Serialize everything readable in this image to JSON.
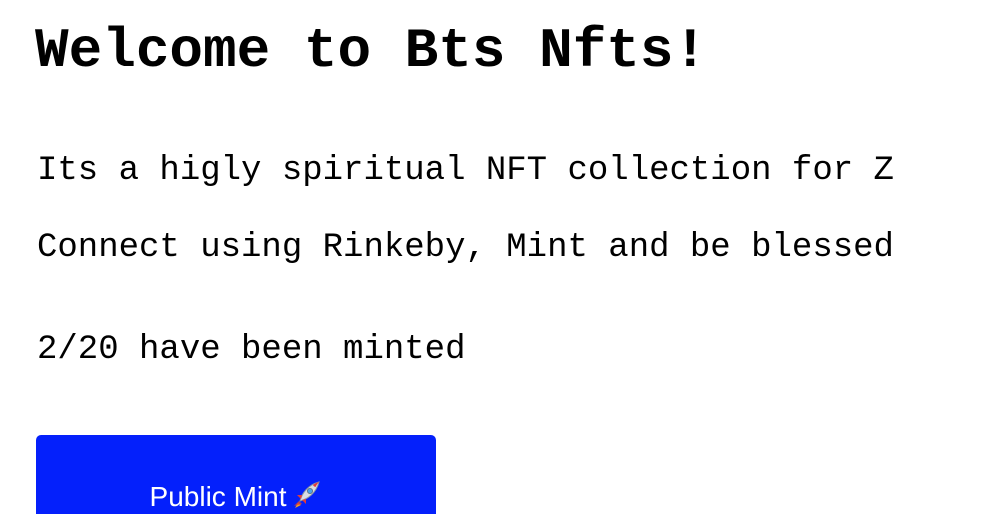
{
  "header": {
    "title": "Welcome to Bts Nfts!"
  },
  "content": {
    "description": "Its a higly spiritual NFT collection for Z",
    "instructions": "Connect using Rinkeby, Mint and be blessed",
    "mint_count_text": "2/20 have been minted"
  },
  "mint_button": {
    "label": "Public Mint",
    "icon": "rocket-icon",
    "color": "#0420fb",
    "text_color": "#ffffff"
  }
}
